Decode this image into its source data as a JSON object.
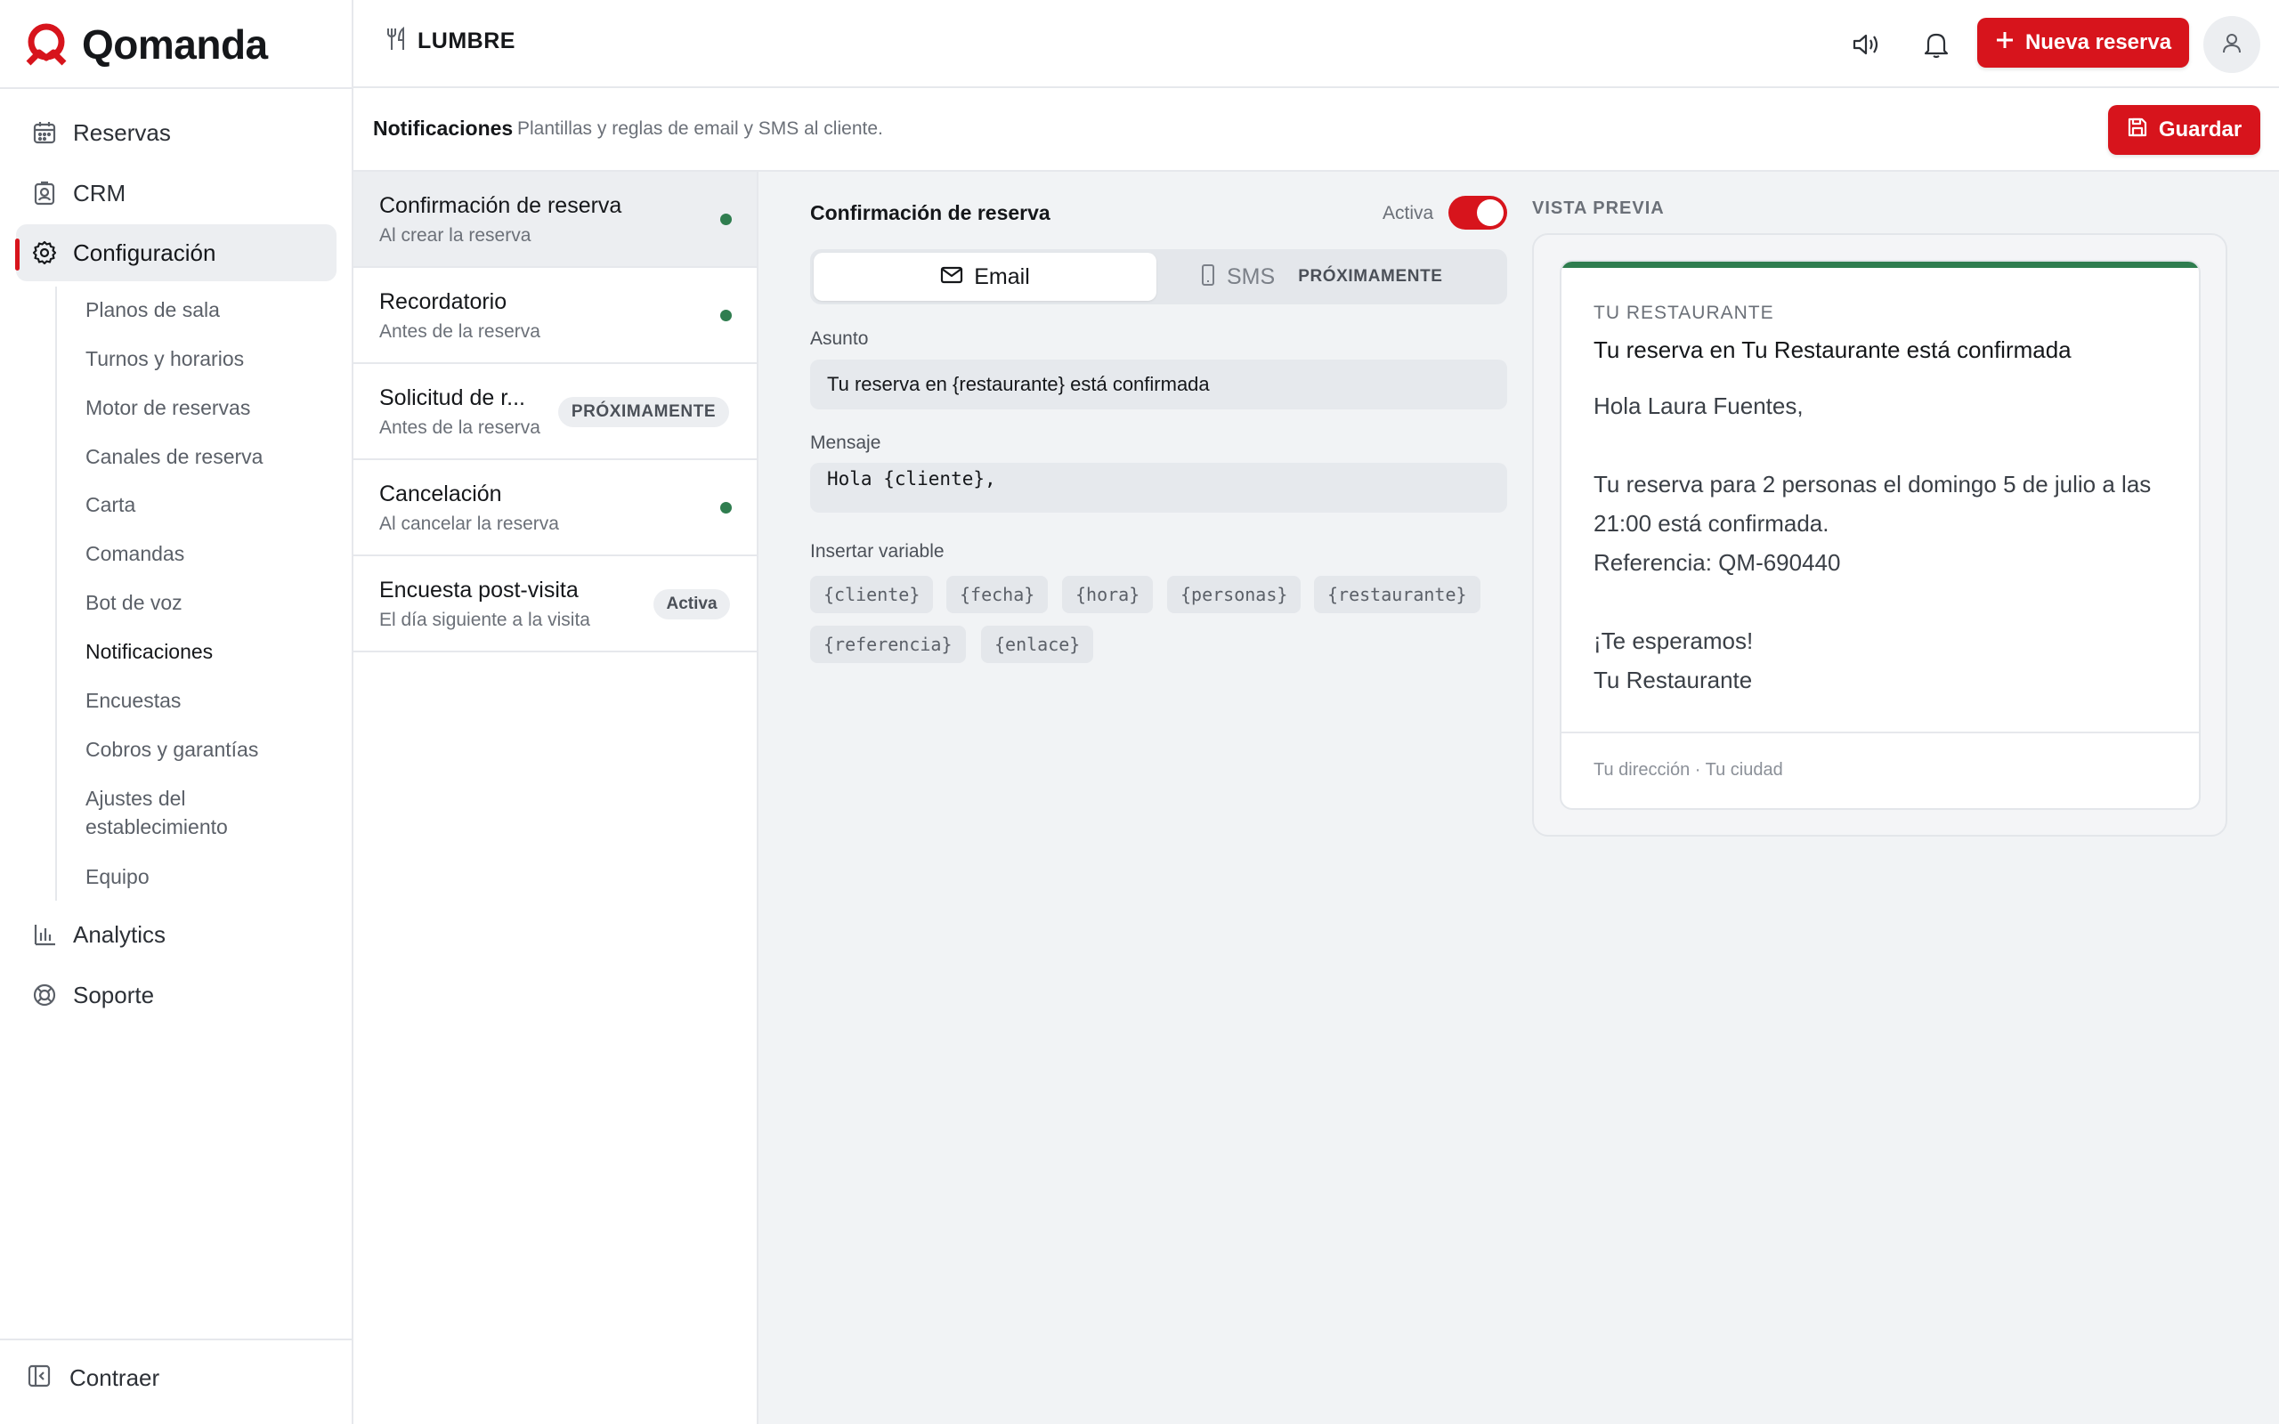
{
  "app": {
    "name": "Qomanda",
    "brand_color": "#d7141c",
    "success_color": "#2f7d4f"
  },
  "sidebar": {
    "items": [
      {
        "label": "Reservas",
        "icon": "calendar-icon"
      },
      {
        "label": "CRM",
        "icon": "contact-card-icon"
      },
      {
        "label": "Configuración",
        "icon": "gear-icon",
        "active": true
      },
      {
        "label": "Analytics",
        "icon": "bar-chart-icon"
      },
      {
        "label": "Soporte",
        "icon": "lifebuoy-icon"
      }
    ],
    "sub_items": [
      "Planos de sala",
      "Turnos y horarios",
      "Motor de reservas",
      "Canales de reserva",
      "Carta",
      "Comandas",
      "Bot de voz",
      "Notificaciones",
      "Encuestas",
      "Cobros y garantías",
      "Ajustes del establecimiento",
      "Equipo"
    ],
    "active_sub": "Notificaciones",
    "collapse_label": "Contraer"
  },
  "topbar": {
    "venue": "LUMBRE",
    "new_reservation_label": "Nueva reserva"
  },
  "subheader": {
    "title": "Notificaciones",
    "description": "Plantillas y reglas de email y SMS al cliente.",
    "save_label": "Guardar"
  },
  "templates": [
    {
      "title": "Confirmación de reserva",
      "subtitle": "Al crear la reserva",
      "status": "dot"
    },
    {
      "title": "Recordatorio",
      "subtitle": "Antes de la reserva",
      "status": "dot"
    },
    {
      "title": "Solicitud de r...",
      "subtitle": "Antes de la reserva",
      "status": "PRÓXIMAMENTE"
    },
    {
      "title": "Cancelación",
      "subtitle": "Al cancelar la reserva",
      "status": "dot"
    },
    {
      "title": "Encuesta post-visita",
      "subtitle": "El día siguiente a la visita",
      "status": "Activa"
    }
  ],
  "editor": {
    "title": "Confirmación de reserva",
    "active_label": "Activa",
    "active": true,
    "tabs": {
      "email": "Email",
      "sms": "SMS",
      "sms_badge": "PRÓXIMAMENTE",
      "selected": "Email"
    },
    "subject_label": "Asunto",
    "subject_value": "Tu reserva en {restaurante} está confirmada",
    "message_label": "Mensaje",
    "message_value": "Hola {cliente},",
    "variables_label": "Insertar variable",
    "variables": [
      "{cliente}",
      "{fecha}",
      "{hora}",
      "{personas}",
      "{restaurante}",
      "{referencia}",
      "{enlace}"
    ]
  },
  "preview": {
    "label": "VISTA PREVIA",
    "restaurant": "TU RESTAURANTE",
    "subject": "Tu reserva en Tu Restaurante está confirmada",
    "body": [
      "Hola Laura Fuentes,",
      "",
      "Tu reserva para 2 personas el domingo 5 de julio a las 21:00 está confirmada.",
      "Referencia: QM-690440",
      "",
      "¡Te esperamos!",
      "Tu Restaurante"
    ],
    "footer": "Tu dirección · Tu ciudad"
  }
}
